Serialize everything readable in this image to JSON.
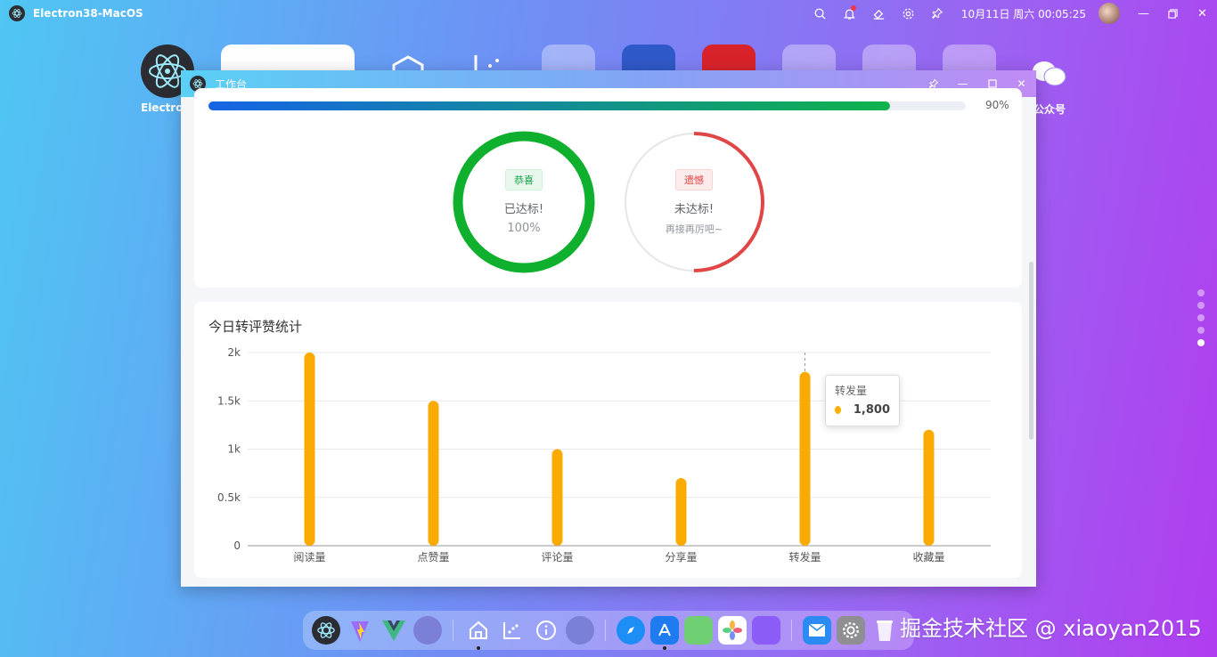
{
  "menubar": {
    "app_title": "Electron38-MacOS",
    "clock": "10月11日 周六 00:05:25",
    "icons": [
      "search-icon",
      "bell-icon",
      "skin-icon",
      "settings-icon",
      "pin-icon"
    ]
  },
  "desktop": {
    "labels": {
      "electron": "Electron",
      "wechat": "公众号"
    }
  },
  "window": {
    "title": "工作台",
    "progress": {
      "value": 90,
      "text": "90%"
    },
    "rings": [
      {
        "tag": "恭喜",
        "line1": "已达标!",
        "line2": "100%",
        "percent": 100,
        "color": "#0fb02e"
      },
      {
        "tag": "遗憾",
        "line1": "未达标!",
        "line2": "再接再厉吧~",
        "percent": 50,
        "color": "#e04646"
      }
    ],
    "chart_card": {
      "title": "今日转评赞统计"
    }
  },
  "chart_data": {
    "type": "bar",
    "title": "今日转评赞统计",
    "categories": [
      "阅读量",
      "点赞量",
      "评论量",
      "分享量",
      "转发量",
      "收藏量"
    ],
    "values": [
      2000,
      1500,
      1000,
      700,
      1800,
      1200
    ],
    "ylim": [
      0,
      2000
    ],
    "yticks": [
      0,
      500,
      1000,
      1500,
      2000
    ],
    "ytick_labels": [
      "0",
      "0.5k",
      "1k",
      "1.5k",
      "2k"
    ],
    "color": "#fbaa00",
    "grid": true,
    "tooltip": {
      "name": "转发量",
      "value": "1,800"
    }
  },
  "watermark": "掘金技术社区 @ xiaoyan2015"
}
